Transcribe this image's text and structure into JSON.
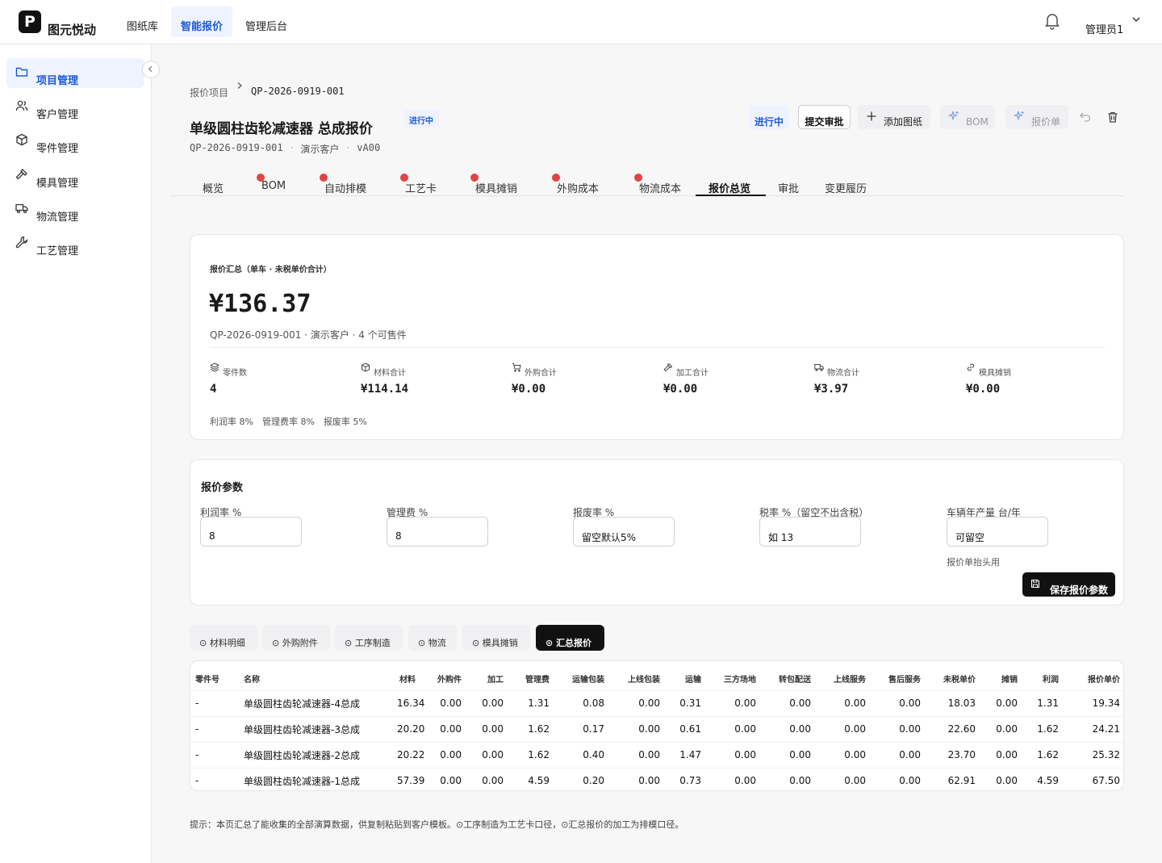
{
  "app": {
    "logo_letter": "P",
    "name": "图元悦动",
    "nav": [
      "图纸库",
      "智能报价",
      "管理后台"
    ],
    "active_nav": "智能报价",
    "user": "管理员1"
  },
  "sidebar": {
    "items": [
      {
        "label": "项目管理",
        "icon": "folder-icon",
        "active": true
      },
      {
        "label": "客户管理",
        "icon": "users-icon",
        "active": false
      },
      {
        "label": "零件管理",
        "icon": "cube-icon",
        "active": false
      },
      {
        "label": "模具管理",
        "icon": "hammer-icon",
        "active": false
      },
      {
        "label": "物流管理",
        "icon": "truck-icon",
        "active": false
      },
      {
        "label": "工艺管理",
        "icon": "wrench-icon",
        "active": false
      }
    ]
  },
  "breadcrumb": {
    "parent": "报价项目",
    "current": "QP-2026-0919-001"
  },
  "project": {
    "title": "单级圆柱齿轮减速器 总成报价",
    "status": "进行中",
    "code": "QP-2026-0919-001",
    "customer": "演示客户",
    "version": "vA00"
  },
  "actions": {
    "status_badge": "进行中",
    "submit": "提交审批",
    "add_drawing": "添加图纸",
    "bom": "BOM",
    "quote_sheet": "报价单"
  },
  "tabs": [
    {
      "label": "概览",
      "dot": false
    },
    {
      "label": "BOM",
      "dot": true
    },
    {
      "label": "自动排模",
      "dot": true
    },
    {
      "label": "工艺卡",
      "dot": true
    },
    {
      "label": "模具摊销",
      "dot": true
    },
    {
      "label": "外购成本",
      "dot": true
    },
    {
      "label": "物流成本",
      "dot": true
    },
    {
      "label": "报价总览",
      "dot": false,
      "active": true
    },
    {
      "label": "审批",
      "dot": false
    },
    {
      "label": "变更履历",
      "dot": false
    }
  ],
  "summary": {
    "label": "报价汇总（单车 · 未税单价合计）",
    "total": "¥136.37",
    "subtitle": "QP-2026-0919-001 · 演示客户 · 4 个可售件",
    "stats": [
      {
        "label": "零件数",
        "value": "4",
        "icon": "layers-icon"
      },
      {
        "label": "材料合计",
        "value": "¥114.14",
        "icon": "box-icon"
      },
      {
        "label": "外购合计",
        "value": "¥0.00",
        "icon": "cart-icon"
      },
      {
        "label": "加工合计",
        "value": "¥0.00",
        "icon": "hammer-icon"
      },
      {
        "label": "物流合计",
        "value": "¥3.97",
        "icon": "truck-icon"
      },
      {
        "label": "模具摊销",
        "value": "¥0.00",
        "icon": "link-icon"
      }
    ],
    "rates": [
      "利润率 8%",
      "管理费率 8%",
      "报废率 5%"
    ]
  },
  "params": {
    "title": "报价参数",
    "fields": [
      {
        "label": "利润率 %",
        "value": "8"
      },
      {
        "label": "管理费 %",
        "value": "8"
      },
      {
        "label": "报废率 %",
        "value": "留空默认5%"
      },
      {
        "label": "税率 %（留空不出含税）",
        "value": "如 13"
      },
      {
        "label": "车辆年产量 台/年",
        "value": "可留空"
      }
    ],
    "hint": "报价单抬头用",
    "save": "保存报价参数"
  },
  "subtabs": [
    {
      "label": "⊙ 材料明细",
      "active": false
    },
    {
      "label": "⊙ 外购附件",
      "active": false
    },
    {
      "label": "⊙ 工序制造",
      "active": false
    },
    {
      "label": "⊙ 物流",
      "active": false
    },
    {
      "label": "⊙ 模具摊销",
      "active": false
    },
    {
      "label": "⊙ 汇总报价",
      "active": true
    }
  ],
  "table": {
    "headers": [
      "零件号",
      "名称",
      "材料",
      "外购件",
      "加工",
      "管理费",
      "运输包装",
      "上线包装",
      "运输",
      "三方场地",
      "转包配送",
      "上线服务",
      "售后服务",
      "未税单价",
      "摊销",
      "利润",
      "报价单价"
    ],
    "rows": [
      [
        "-",
        "单级圆柱齿轮减速器-4总成",
        "16.34",
        "0.00",
        "0.00",
        "1.31",
        "0.08",
        "0.00",
        "0.31",
        "0.00",
        "0.00",
        "0.00",
        "0.00",
        "18.03",
        "0.00",
        "1.31",
        "19.34"
      ],
      [
        "-",
        "单级圆柱齿轮减速器-3总成",
        "20.20",
        "0.00",
        "0.00",
        "1.62",
        "0.17",
        "0.00",
        "0.61",
        "0.00",
        "0.00",
        "0.00",
        "0.00",
        "22.60",
        "0.00",
        "1.62",
        "24.21"
      ],
      [
        "-",
        "单级圆柱齿轮减速器-2总成",
        "20.22",
        "0.00",
        "0.00",
        "1.62",
        "0.40",
        "0.00",
        "1.47",
        "0.00",
        "0.00",
        "0.00",
        "0.00",
        "23.70",
        "0.00",
        "1.62",
        "25.32"
      ],
      [
        "-",
        "单级圆柱齿轮减速器-1总成",
        "57.39",
        "0.00",
        "0.00",
        "4.59",
        "0.20",
        "0.00",
        "0.73",
        "0.00",
        "0.00",
        "0.00",
        "0.00",
        "62.91",
        "0.00",
        "4.59",
        "67.50"
      ]
    ]
  },
  "footnote": "提示：本页汇总了能收集的全部演算数据，供复制粘贴到客户模板。⊙工序制造为工艺卡口径，⊙汇总报价的加工为排模口径。"
}
